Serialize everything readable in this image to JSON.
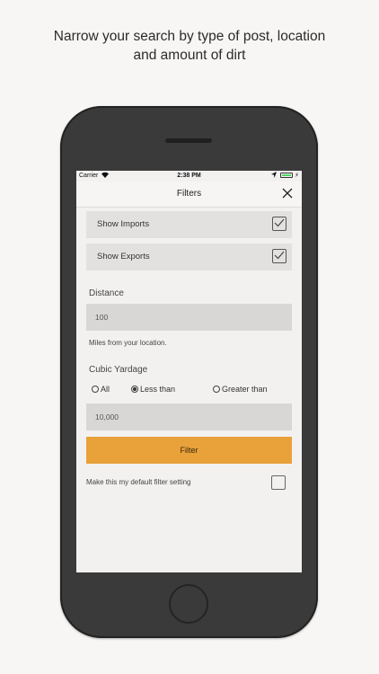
{
  "caption": {
    "line1": "Narrow your search by type of post, location",
    "line2": "and amount of dirt"
  },
  "status_bar": {
    "carrier": "Carrier",
    "time": "2:38 PM"
  },
  "nav": {
    "title": "Filters",
    "close_icon": "close-icon"
  },
  "toggles": [
    {
      "label": "Show Imports",
      "checked": true
    },
    {
      "label": "Show Exports",
      "checked": true
    }
  ],
  "distance": {
    "label": "Distance",
    "value": "100",
    "hint": "Miles from your location."
  },
  "cubic_yardage": {
    "label": "Cubic Yardage",
    "options": [
      "All",
      "Less than",
      "Greater than"
    ],
    "selected": "Less than",
    "value": "10,000"
  },
  "filter_button": {
    "label": "Filter",
    "color": "#e9a13a"
  },
  "default_setting": {
    "label": "Make this my default filter setting",
    "checked": false
  }
}
